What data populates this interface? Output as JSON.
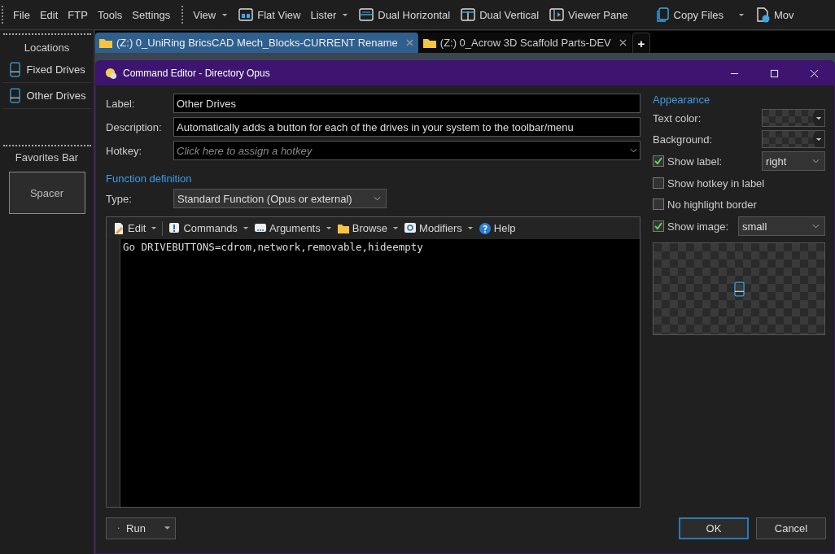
{
  "menu": [
    "File",
    "Edit",
    "FTP",
    "Tools",
    "Settings"
  ],
  "toolbar": [
    {
      "label": "View",
      "kind": "menu"
    },
    {
      "label": "Flat View",
      "kind": "button"
    },
    {
      "label": "Lister",
      "kind": "menu"
    },
    {
      "label": "Dual Horizontal",
      "kind": "button"
    },
    {
      "label": "Dual Vertical",
      "kind": "button"
    },
    {
      "label": "Viewer Pane",
      "kind": "button"
    },
    {
      "label": "Copy Files",
      "kind": "split"
    },
    {
      "label": "Mov",
      "kind": "button"
    }
  ],
  "sidebar": {
    "locations_title": "Locations",
    "items": [
      "Fixed Drives",
      "Other Drives"
    ],
    "favorites_title": "Favorites Bar",
    "spacer": "Spacer"
  },
  "tabs": [
    {
      "label": "(Z:) 0_UniRing BricsCAD Mech_Blocks-CURRENT Rename",
      "selected": true
    },
    {
      "label": "(Z:) 0_Acrow 3D Scaffold Parts-DEV",
      "selected": false
    }
  ],
  "new_tab": "+",
  "dialog": {
    "title": "Command Editor - Directory Opus",
    "fields": [
      {
        "label": "Label:",
        "value": "Other Drives",
        "kind": "text"
      },
      {
        "label": "Description:",
        "value": "Automatically adds a button for each of the drives in your system to the toolbar/menu",
        "kind": "text"
      },
      {
        "label": "Hotkey:",
        "placeholder": "Click here to assign a hotkey",
        "kind": "hotkey"
      }
    ],
    "function_title": "Function definition",
    "type_label": "Type:",
    "type_value": "Standard Function (Opus or external)",
    "editor_toolbar": [
      "Edit",
      "Commands",
      "Arguments",
      "Browse",
      "Modifiers",
      "Help"
    ],
    "code": "Go DRIVEBUTTONS=cdrom,network,removable,hideempty",
    "appearance": {
      "title": "Appearance",
      "colors": [
        {
          "label": "Text color:"
        },
        {
          "label": "Background:"
        }
      ],
      "options": [
        {
          "label": "Show label:",
          "checked": true,
          "select": "right"
        },
        {
          "label": "Show hotkey in label",
          "checked": false
        },
        {
          "label": "No highlight border",
          "checked": false
        },
        {
          "label": "Show image:",
          "checked": true,
          "select": "small"
        }
      ]
    },
    "buttons": [
      {
        "label": "Run",
        "kind": "run"
      },
      {
        "label": "OK",
        "kind": "default"
      },
      {
        "label": "Cancel",
        "kind": "normal"
      }
    ]
  }
}
